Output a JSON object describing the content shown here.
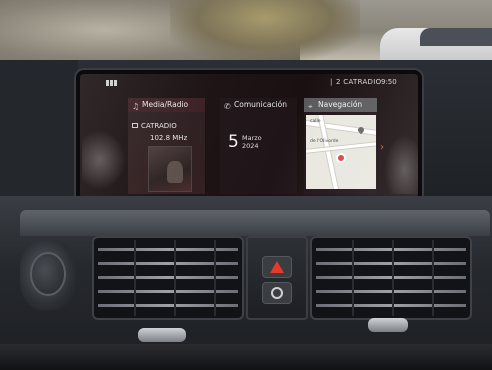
{
  "status_bar": {
    "separator": "|",
    "station": "2  CATRADIO",
    "time": "9:50"
  },
  "tiles": {
    "media": {
      "title": "Media/Radio",
      "icon": "music-note-icon",
      "source": "CATRADIO",
      "frequency": "102.8 MHz"
    },
    "communication": {
      "title": "Comunicación",
      "icon": "phone-icon",
      "day": "5",
      "month": "Marzo",
      "year": "2024"
    },
    "navigation": {
      "title": "Navegación",
      "icon": "map-pin-icon",
      "map_label_1": "calle",
      "map_label_2": "de l'Olivorde"
    }
  },
  "colors": {
    "active_tile_header": "#3a1e22",
    "nav_header": "#5a5a5c",
    "hazard": "#e23b2b"
  }
}
